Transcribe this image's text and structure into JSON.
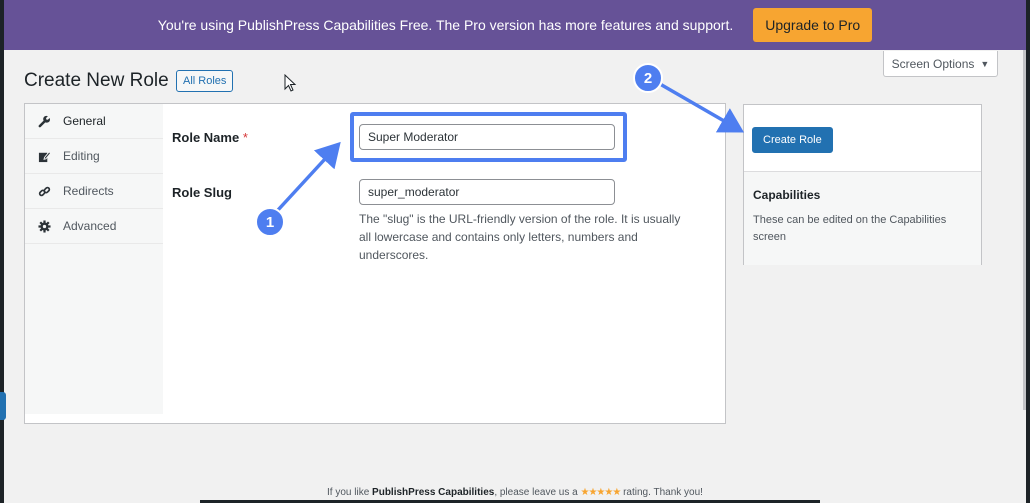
{
  "promo": {
    "text": "You're using PublishPress Capabilities Free. The Pro version has more features and support.",
    "upgrade_label": "Upgrade to Pro"
  },
  "screen_options": {
    "label": "Screen Options",
    "caret": "▼"
  },
  "header": {
    "title": "Create New Role",
    "all_roles_label": "All Roles"
  },
  "tabs": [
    {
      "label": "General",
      "icon": "wrench-icon"
    },
    {
      "label": "Editing",
      "icon": "edit-icon"
    },
    {
      "label": "Redirects",
      "icon": "link-icon"
    },
    {
      "label": "Advanced",
      "icon": "gear-icon"
    }
  ],
  "form": {
    "role_name_label": "Role Name",
    "required_mark": "*",
    "role_name_value": "Super Moderator",
    "role_slug_label": "Role Slug",
    "role_slug_value": "super_moderator",
    "slug_help": "The \"slug\" is the URL-friendly version of the role. It is usually all lowercase and contains only letters, numbers and underscores."
  },
  "sidebar": {
    "create_label": "Create Role",
    "capabilities_title": "Capabilities",
    "capabilities_text": "These can be edited on the Capabilities screen"
  },
  "annotations": {
    "step1": "1",
    "step2": "2"
  },
  "footer": {
    "prefix": "If you like ",
    "product": "PublishPress Capabilities",
    "middle": ", please leave us a ",
    "stars": "★★★★★",
    "suffix": " rating. Thank you!"
  },
  "colors": {
    "promo_bg": "#665297",
    "upgrade_bg": "#f7a531",
    "primary": "#2271b1",
    "annotation": "#4e7ef0"
  }
}
